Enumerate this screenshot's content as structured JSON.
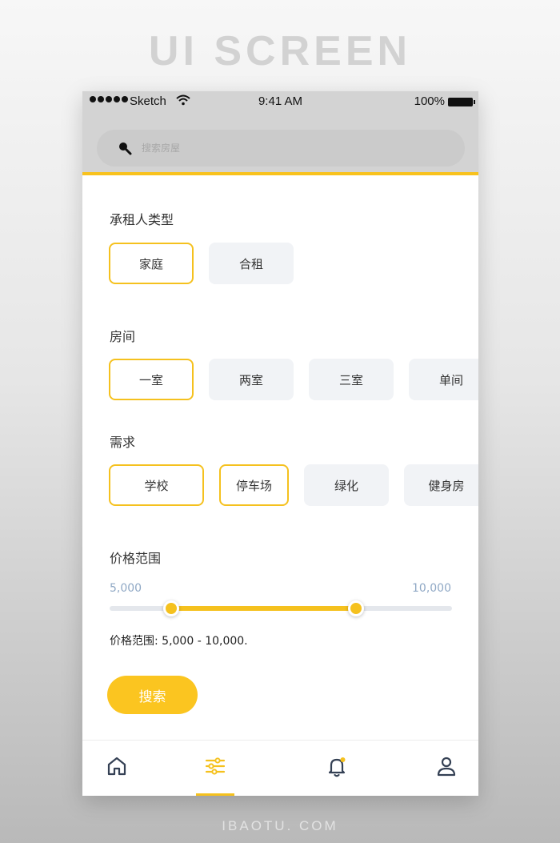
{
  "poster": {
    "title": "UI SCREEN",
    "footer": "IBAOTU. COM"
  },
  "status_bar": {
    "carrier": "Sketch",
    "time": "9:41 AM",
    "battery": "100%"
  },
  "search": {
    "placeholder": "搜索房屋",
    "value": ""
  },
  "filters": {
    "tenant_type": {
      "title": "承租人类型",
      "options": [
        {
          "label": "家庭",
          "selected": true
        },
        {
          "label": "合租",
          "selected": false
        }
      ]
    },
    "rooms": {
      "title": "房间",
      "options": [
        {
          "label": "一室",
          "selected": true
        },
        {
          "label": "两室",
          "selected": false
        },
        {
          "label": "三室",
          "selected": false
        },
        {
          "label": "单间",
          "selected": false
        }
      ]
    },
    "needs": {
      "title": "需求",
      "options": [
        {
          "label": "学校",
          "selected": true
        },
        {
          "label": "停车场",
          "selected": true
        },
        {
          "label": "绿化",
          "selected": false
        },
        {
          "label": "健身房",
          "selected": false
        }
      ]
    },
    "price": {
      "title": "价格范围",
      "min_label": "5,000",
      "max_label": "10,000",
      "range_start_fraction": 0.18,
      "range_end_fraction": 0.72,
      "summary": "价格范围: 5,000 - 10,000."
    }
  },
  "search_button": "搜索",
  "tab_bar": {
    "tabs": [
      {
        "icon": "home-icon"
      },
      {
        "icon": "filter-sliders-icon",
        "active": true
      },
      {
        "icon": "bell-icon",
        "badge": true
      },
      {
        "icon": "user-icon"
      }
    ]
  },
  "colors": {
    "accent": "#f5c11e",
    "chip_bg": "#f1f3f6",
    "header_bg": "#d3d3d3",
    "price_label": "#8fa8c5"
  }
}
